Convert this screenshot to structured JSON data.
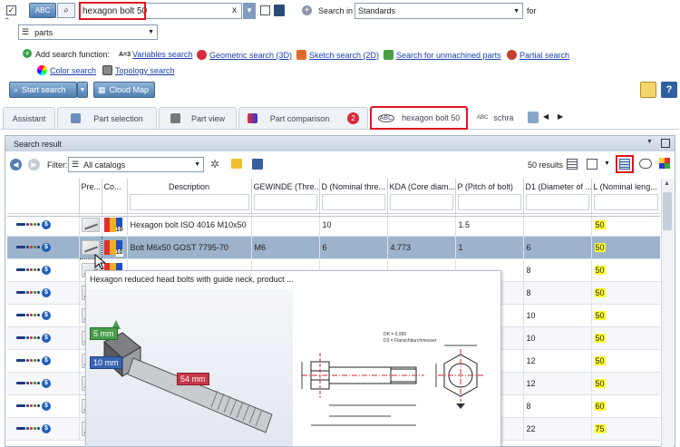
{
  "search": {
    "query": "hexagon bolt 50",
    "abc_label": "ABC",
    "clear_label": "x",
    "search_in_label": "Search in",
    "search_in_value": "Standards",
    "for_label": "for",
    "scope_value": "parts"
  },
  "functions": {
    "add_label": "Add search function:",
    "items": [
      "Variables search",
      "Geometric search (3D)",
      "Sketch search (2D)",
      "Search for unmachined parts",
      "Partial search",
      "Color search",
      "Topology search"
    ]
  },
  "toolbar": {
    "start_search": "Start search",
    "cloud_map": "Cloud Map"
  },
  "tabs": {
    "assistant": "Assistant",
    "part_selection": "Part selection",
    "part_view": "Part view",
    "part_comparison": "Part comparison",
    "badge": "2",
    "result_tab": "hexagon bolt 50",
    "result_tab2": "schra"
  },
  "panel": {
    "title": "Search result",
    "filter_label": "Filter:",
    "filter_value": "All catalogs",
    "results": "50 results"
  },
  "table": {
    "headers": [
      "Pre...",
      "Co...",
      "Description",
      "GEWINDE (Thre...",
      "D (Nominal thre...",
      "KDA (Core diam...",
      "P (Pitch of bolt)",
      "D1 (Diameter of ...",
      "L (Nominal leng..."
    ],
    "rows": [
      {
        "desc": "Hexagon bolt ISO 4016 M10x50",
        "gewinde": "",
        "d": "10",
        "kda": "",
        "p": "1.5",
        "d1": "",
        "l": "50"
      },
      {
        "desc": "Bolt M6x50 GOST 7795-70",
        "gewinde": "M6",
        "d": "6",
        "kda": "4.773",
        "p": "1",
        "d1": "6",
        "l": "50"
      },
      {
        "desc": "",
        "gewinde": "",
        "d": "",
        "kda": "",
        "p": "",
        "d1": "8",
        "l": "50"
      },
      {
        "desc": "",
        "gewinde": "",
        "d": "",
        "kda": "",
        "p": "",
        "d1": "8",
        "l": "50"
      },
      {
        "desc": "",
        "gewinde": "",
        "d": "",
        "kda": "",
        "p": "",
        "d1": "10",
        "l": "50"
      },
      {
        "desc": "",
        "gewinde": "",
        "d": "",
        "kda": "",
        "p": "",
        "d1": "10",
        "l": "50"
      },
      {
        "desc": "",
        "gewinde": "",
        "d": "",
        "kda": "",
        "p": "",
        "d1": "12",
        "l": "50"
      },
      {
        "desc": "",
        "gewinde": "",
        "d": "",
        "kda": "",
        "p": "",
        "d1": "12",
        "l": "50"
      },
      {
        "desc": "",
        "gewinde": "",
        "d": "",
        "kda": "",
        "p": "",
        "d1": "8",
        "l": "60"
      },
      {
        "desc": "",
        "gewinde": "",
        "d": "",
        "kda": "",
        "p": "",
        "d1": "22",
        "l": "75"
      }
    ]
  },
  "preview": {
    "title": "Hexagon reduced head bolts with guide neck, product ...",
    "dim1": "5 mm",
    "dim2": "10 mm",
    "dim3": "54 mm",
    "note1": "DK = 0,955",
    "note2": "D2 = Flanschdurchmesser"
  },
  "colors": {
    "selected_row": "#9db3cc",
    "highlight": "#ffff2a",
    "red_outline": "#e0141e"
  }
}
